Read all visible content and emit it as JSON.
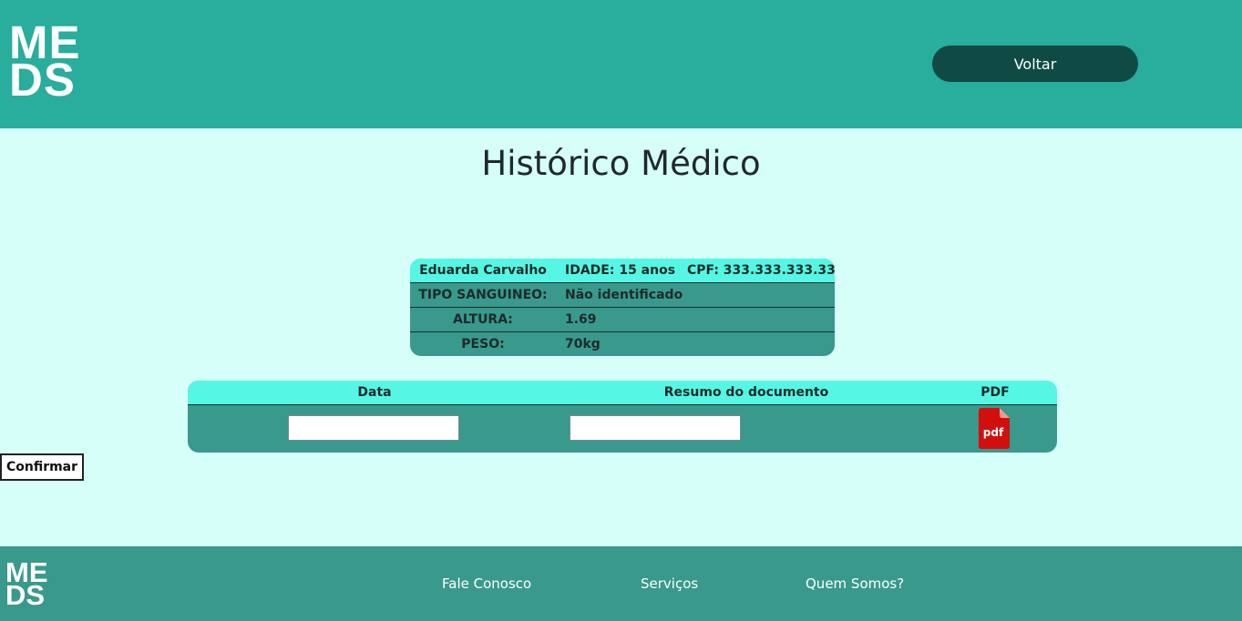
{
  "header": {
    "logo_line1": "ME",
    "logo_line2": "DS",
    "back_label": "Voltar"
  },
  "page_title": "Histórico Médico",
  "patient": {
    "name": "Eduarda Carvalho",
    "age": "IDADE: 15 anos",
    "cpf": "CPF: 333.333.333.33",
    "blood_label": "TIPO SANGUINEO:",
    "blood_value": "Não identificado",
    "height_label": "ALTURA:",
    "height_value": "1.69",
    "weight_label": "PESO:",
    "weight_value": "70kg"
  },
  "documents": {
    "columns": [
      "Data",
      "Resumo do documento",
      "PDF"
    ],
    "date_value": "",
    "summary_value": "",
    "pdf_icon_label": "pdf"
  },
  "confirm_label": "Confirmar",
  "footer": {
    "logo_line1": "ME",
    "logo_line2": "DS",
    "links": [
      "Fale Conosco",
      "Serviços",
      "Quem Somos?"
    ]
  },
  "colors": {
    "header_bg": "#29ad9c",
    "page_bg": "#d7fff9",
    "table_header_bg": "#55f7e4",
    "table_body_bg": "#39998c",
    "button_dark": "#0f4b44",
    "pdf_red": "#d20f0f"
  },
  "icons": {
    "pdf": "pdf-file-icon"
  }
}
